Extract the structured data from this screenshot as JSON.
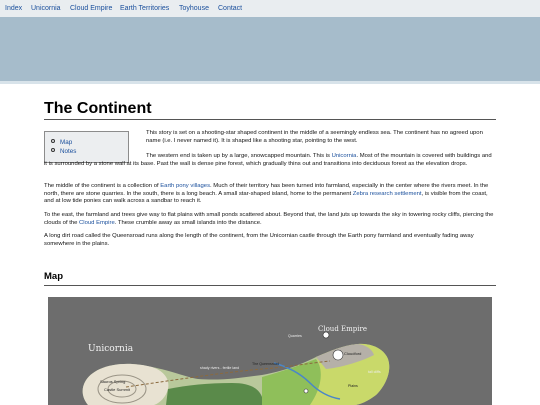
{
  "nav": {
    "items": [
      "Index",
      "Unicornia",
      "Cloud Empire",
      "Earth Territories",
      "Toyhouse",
      "Contact"
    ]
  },
  "page_title": "The Continent",
  "toc": {
    "items": [
      "Map",
      "Notes"
    ]
  },
  "paragraphs": {
    "p1": "This story is set on a shooting-star shaped continent in the middle of a seemingly endless sea. The continent has no agreed upon name (i.e. I never named it). It is shaped like a shooting star, pointing to the west.",
    "p2_a": "The western end is taken up by a large, snowcapped mountain. This is ",
    "p2_link": "Unicornia",
    "p2_b": ". Most of the mountain is covered with buildings and it is surrounded by a stone wall at its base. Past the wall is dense pine forest, which gradually thins out and transitions into deciduous forest as the elevation drops.",
    "p3_a": "The middle of the continent is a collection of ",
    "p3_link1": "Earth pony villages",
    "p3_b": ". Much of their territory has been turned into farmland, especially in the center where the rivers meet. In the north, there are stone quarries. In the south, there is a long beach. A small star-shaped island, home to the permanent ",
    "p3_link2": "Zebra research settlement",
    "p3_c": ", is visible from the coast, and at low tide ponies can walk across a sandbar to reach it.",
    "p4_a": "To the east, the farmland and trees give way to flat plains with small ponds scattered about. Beyond that, the land juts up towards the sky in towering rocky cliffs, piercing the clouds of the ",
    "p4_link": "Cloud Empire",
    "p4_b": ". These crumble away as small islands into the distance.",
    "p5": "A long dirt road called the Queensroad runs along the length of the continent, from the Unicornian castle through the Earth pony farmland and eventually fading away somewhere in the plains."
  },
  "map_section_title": "Map",
  "map": {
    "labels": {
      "unicornia": "Unicornia",
      "cloud_empire": "Cloud Empire",
      "sauros_spring": "Sauros Spring",
      "castle_summit": "Castle Summit",
      "cloudford": "Cloudford",
      "queensroad": "The Queensroad",
      "shady_rivers": "shady rivers - fertile land",
      "quarry": "Quarries",
      "cliffs": "tall cliffs",
      "plains": "Plains"
    },
    "colors": {
      "background": "#6d6d6d",
      "land_west": "#e8e2d2",
      "forest": "#5a8a4a",
      "farmland": "#8fbf5a",
      "plains": "#c9d96a",
      "cliffs": "#b5b0a8",
      "water": "#4a86c8"
    }
  }
}
